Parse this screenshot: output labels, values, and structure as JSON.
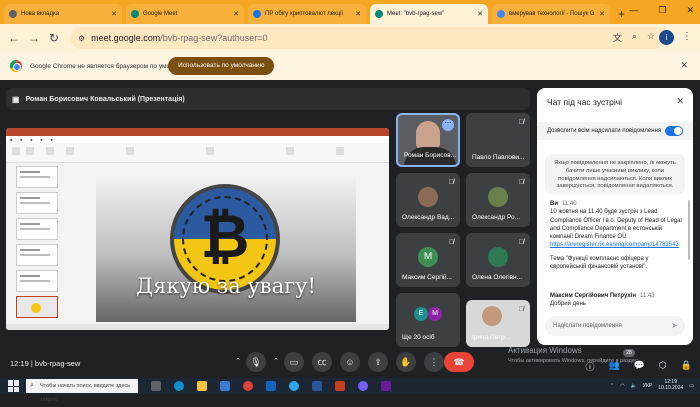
{
  "browser": {
    "tabs": [
      {
        "label": "Нова вкладка",
        "fav": "#5f6368"
      },
      {
        "label": "Google Meet",
        "fav": "#00897b"
      },
      {
        "label": "ПР обігу криптовалют лекції",
        "fav": "#1a73e8"
      },
      {
        "label": "Meet: \"bvb-rpag-sew\"",
        "fav": "#00897b"
      },
      {
        "label": "вмерував технології - Пошук G",
        "fav": "#4285f4"
      }
    ],
    "url_host": "meet.google.com",
    "url_path": "/bvb-rpag-sew?authuser=0",
    "profile_initial": "i",
    "infobar_text": "Google Chrome не является браузером по умолчанию.",
    "infobar_button": "Использовать по умолчанию"
  },
  "meet": {
    "presenter_label": "Роман Борисович Ковальський (Презентація)",
    "slide_text": "Дякую за увагу!",
    "bitcoin_symbol": "₿",
    "participants": [
      {
        "name": "Роман Борисов...",
        "self": true
      },
      {
        "name": "Павло Павлови..."
      },
      {
        "name": "Олександр Вад..."
      },
      {
        "name": "Олександр Ро..."
      },
      {
        "name": "Максим Сергій...",
        "initial": "М"
      },
      {
        "name": "Олена Олегівн..."
      },
      {
        "name": "Ще 20 осіб",
        "initials": [
          "Е",
          "М"
        ]
      },
      {
        "name": "Ірина Петр..."
      }
    ],
    "meeting_time": "12:19",
    "meeting_code": "bvb-rpag-sew",
    "people_count": "28"
  },
  "chat": {
    "title": "Чат під час зустрічі",
    "allow_messages": "Дозволити всім надсилати повідомлення",
    "notice": "Якщо повідомлення не закріплено, їх можуть бачити лише учасники виклику, коли повідомлення надсилаються. Коли виклик завершується, повідомлення видаляються.",
    "messages": [
      {
        "author": "Ви",
        "time": "11:40",
        "text": "10 жовтня на 11.40 буде зустріч з Lead Compliance Officer і в.о. Deputy of Head of Legal and Compliance Department в естонській компанії Dream Finance OÜ",
        "link": "https://areregister.rik.ee/eng/company/14783543",
        "extra": "Тема \"Функції комплаєнс офіцера у європейській фінансовій установі\"."
      },
      {
        "author": "Максим Сергійович Петрухін",
        "time": "11:43",
        "text": "Добрий день"
      }
    ],
    "input_placeholder": "Надіслати повідомлення"
  },
  "system": {
    "activation_title": "Активация Windows",
    "activation_sub": "Чтобы активировать Windows, перейдите в раздел...",
    "search_placeholder": "Чтобы начать поиск, введите здесь запрос",
    "language": "УКР",
    "time": "12:19",
    "date": "10.10.2024"
  },
  "colors": {
    "tabbar": "#f5a623",
    "meet_bg": "#202124",
    "end_call": "#ea4335",
    "accent": "#1a73e8"
  }
}
